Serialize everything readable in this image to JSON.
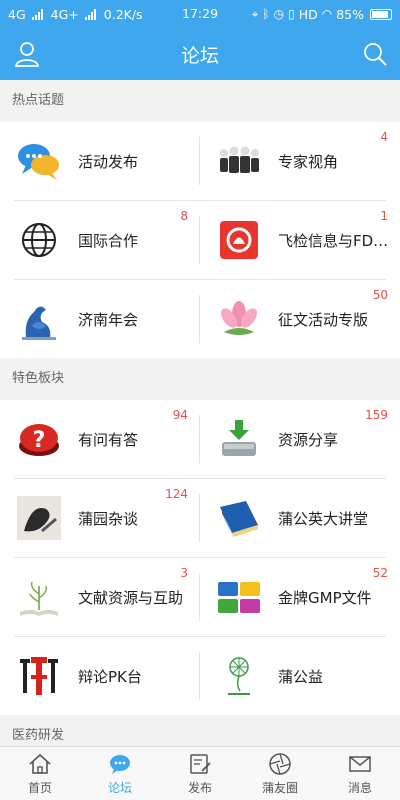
{
  "statusbar": {
    "left": "4G",
    "left2": "4G+",
    "speed": "0.2K/s",
    "time": "17:29",
    "hd": "HD",
    "battery": "85%"
  },
  "header": {
    "title": "论坛"
  },
  "sections": [
    {
      "title": "热点话题",
      "items": [
        {
          "label": "活动发布",
          "count": "",
          "icon": "chat-bubbles-icon"
        },
        {
          "label": "专家视角",
          "count": "4",
          "icon": "business-people-icon"
        },
        {
          "label": "国际合作",
          "count": "8",
          "icon": "globe-icon"
        },
        {
          "label": "飞检信息与FD…",
          "count": "1",
          "icon": "alarm-icon"
        },
        {
          "label": "济南年会",
          "count": "",
          "icon": "sculpture-icon"
        },
        {
          "label": "征文活动专版",
          "count": "50",
          "icon": "lotus-icon"
        }
      ]
    },
    {
      "title": "特色板块",
      "items": [
        {
          "label": "有问有答",
          "count": "94",
          "icon": "question-button-icon"
        },
        {
          "label": "资源分享",
          "count": "159",
          "icon": "download-drive-icon"
        },
        {
          "label": "蒲园杂谈",
          "count": "124",
          "icon": "ink-art-icon"
        },
        {
          "label": "蒲公英大讲堂",
          "count": "",
          "icon": "book-icon"
        },
        {
          "label": "文献资源与互助",
          "count": "3",
          "icon": "open-book-plant-icon"
        },
        {
          "label": "金牌GMP文件",
          "count": "52",
          "icon": "folders-icon"
        },
        {
          "label": "辩论PK台",
          "count": "",
          "icon": "debate-char-icon"
        },
        {
          "label": "蒲公益",
          "count": "",
          "icon": "charity-logo-icon"
        }
      ]
    },
    {
      "title": "医药研发",
      "items": []
    }
  ],
  "tabs": [
    {
      "label": "首页",
      "icon": "home-icon"
    },
    {
      "label": "论坛",
      "icon": "forum-icon",
      "active": true
    },
    {
      "label": "发布",
      "icon": "publish-icon"
    },
    {
      "label": "蒲友圈",
      "icon": "camera-aperture-icon"
    },
    {
      "label": "消息",
      "icon": "mail-icon"
    }
  ],
  "colors": {
    "accent": "#3fa7ee",
    "count": "#e2514a"
  }
}
